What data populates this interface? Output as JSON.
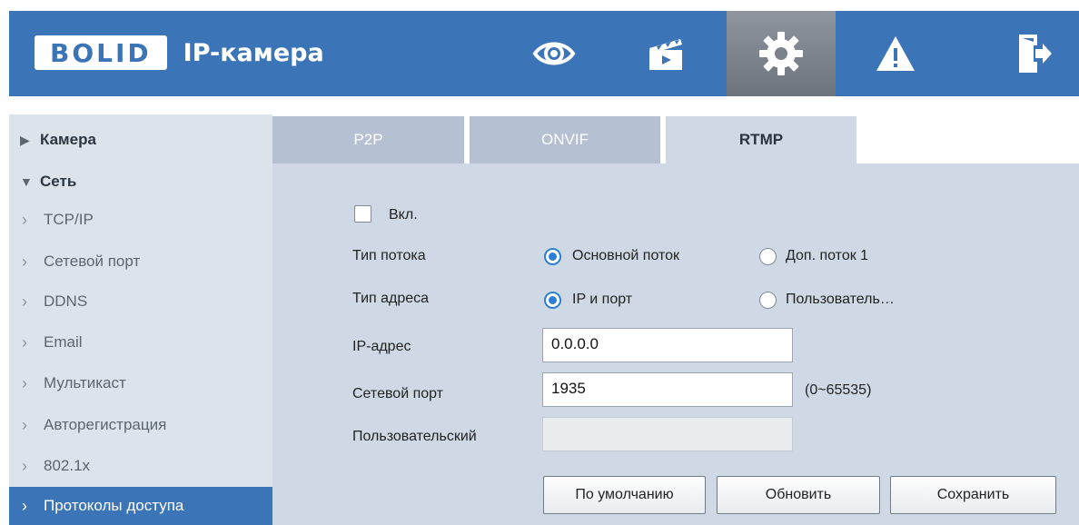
{
  "header": {
    "logo_text": "BOLID",
    "app_title": "IP-камера",
    "nav": [
      {
        "icon": "eye-icon",
        "active": false
      },
      {
        "icon": "clapperboard-icon",
        "active": false
      },
      {
        "icon": "gear-icon",
        "active": true
      },
      {
        "icon": "warning-icon",
        "active": false
      },
      {
        "icon": "logout-icon",
        "active": false
      }
    ]
  },
  "sidebar": {
    "groups": [
      {
        "label": "Камера",
        "expanded": false
      },
      {
        "label": "Сеть",
        "expanded": true
      }
    ],
    "items": [
      "TCP/IP",
      "Сетевой порт",
      "DDNS",
      "Email",
      "Мультикаст",
      "Авторегистрация",
      "802.1x",
      "Протоколы доступа"
    ],
    "selected": "Протоколы доступа"
  },
  "tabs": [
    "P2P",
    "ONVIF",
    "RTMP"
  ],
  "active_tab": "RTMP",
  "form": {
    "enable_label": "Вкл.",
    "enable_checked": false,
    "stream_type_label": "Тип потока",
    "stream_options": [
      "Основной поток",
      "Доп. поток 1"
    ],
    "stream_selected": "Основной поток",
    "address_type_label": "Тип адреса",
    "address_options": [
      "IP и порт",
      "Пользователь…"
    ],
    "address_selected": "IP и порт",
    "ip_label": "IP-адрес",
    "ip_value": "0.0.0.0",
    "port_label": "Сетевой порт",
    "port_value": "1935",
    "port_hint": "(0~65535)",
    "custom_label": "Пользовательский",
    "custom_value": ""
  },
  "buttons": {
    "default": "По умолчанию",
    "refresh": "Обновить",
    "save": "Сохранить"
  }
}
